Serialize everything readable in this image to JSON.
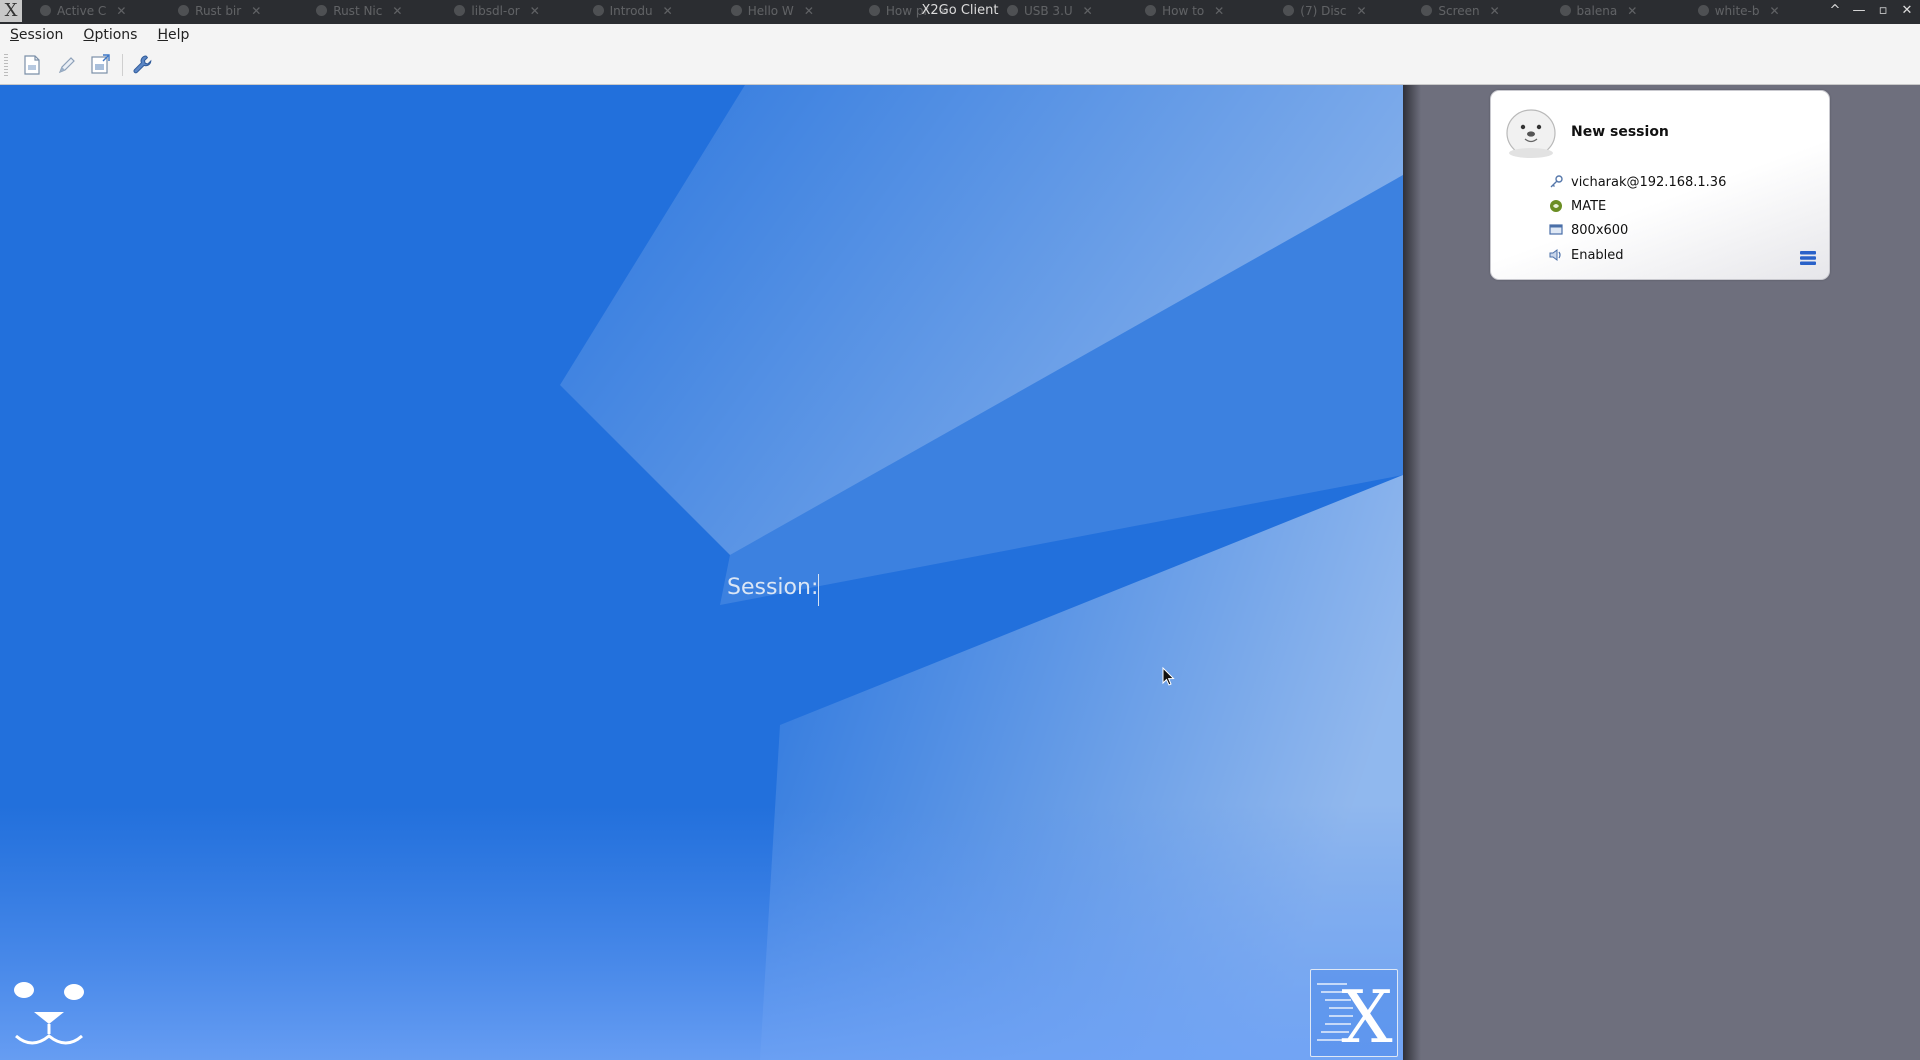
{
  "window": {
    "title": "X2Go Client",
    "controls": [
      "^",
      "—",
      "▫",
      "✕"
    ]
  },
  "background_tabs": [
    "Active C",
    "Rust bir",
    "Rust Nic",
    "libsdl-or",
    "Introdu",
    "Hello W",
    "How pr",
    "USB 3.U",
    "How to",
    "(7) Disc",
    "Screen",
    "balena",
    "white-b"
  ],
  "menu": {
    "items": [
      "Session",
      "Options",
      "Help"
    ]
  },
  "toolbar": {
    "buttons": [
      "new-session-icon",
      "edit-session-icon",
      "export-session-icon",
      "preferences-wrench-icon"
    ]
  },
  "main": {
    "session_label": "Session:",
    "session_value": ""
  },
  "session_card": {
    "title": "New session",
    "host": "vicharak@192.168.1.36",
    "desktop": "MATE",
    "resolution": "800x600",
    "sound": "Enabled"
  },
  "colors": {
    "background_blue": "#2270dc",
    "sidebar_gray": "#6e6f7d",
    "titlebar": "#2b2d31"
  }
}
